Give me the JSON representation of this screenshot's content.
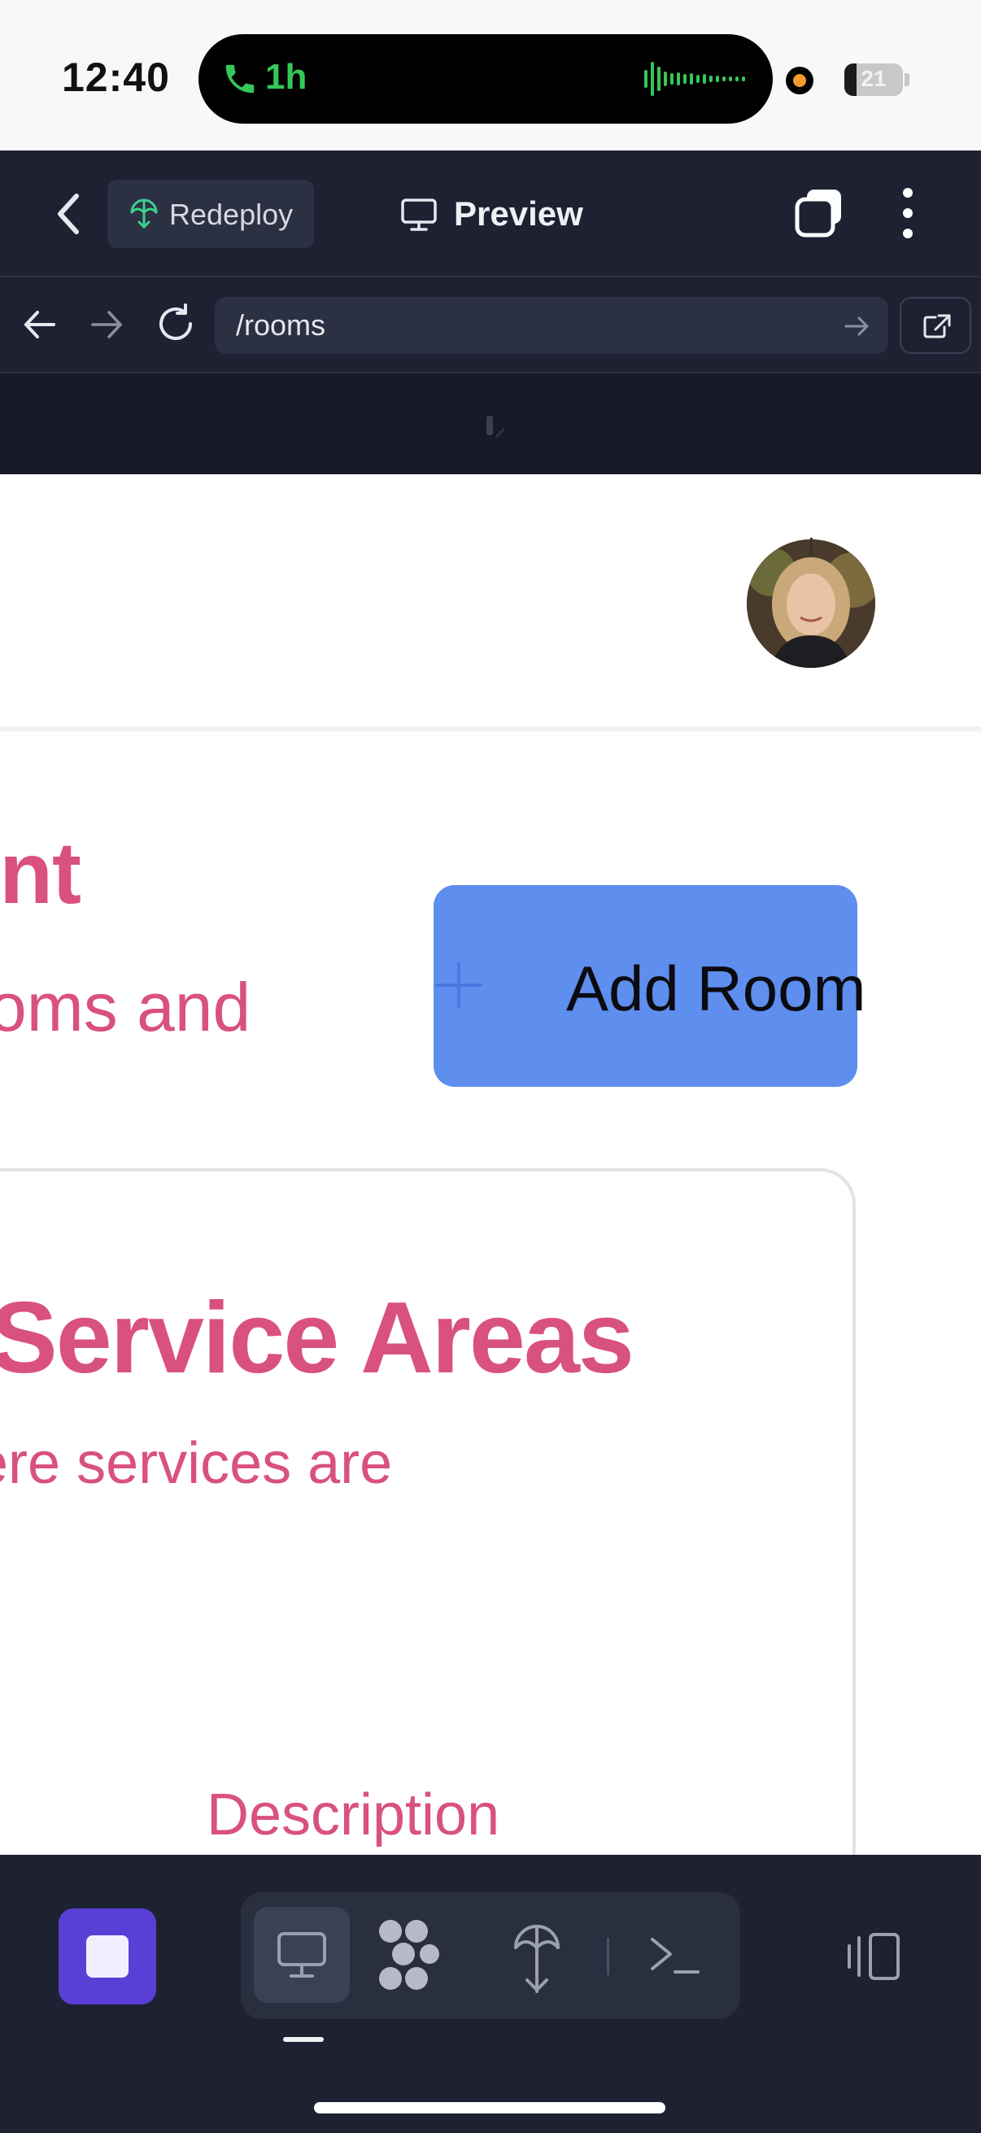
{
  "status_bar": {
    "time": "12:40",
    "call_duration": "1h",
    "battery_level": "21",
    "battery_fraction": 0.21,
    "call_color": "#34c759",
    "recording_color": "#f59a2c"
  },
  "app_toolbar": {
    "redeploy_label": "Redeploy",
    "preview_label": "Preview",
    "icons": [
      "back-icon",
      "redeploy-icon",
      "monitor-icon",
      "tabs-icon",
      "more-vertical-icon"
    ]
  },
  "address_bar": {
    "url": "/rooms",
    "icons": [
      "arrow-left-icon",
      "arrow-right-icon",
      "reload-icon",
      "go-arrow-icon",
      "open-external-icon"
    ]
  },
  "page": {
    "title": "ent",
    "subtitle": "oms and",
    "add_room_label": "Add Room",
    "card": {
      "title": "Service Areas",
      "subtitle": "ere services are",
      "description_label": "Description"
    },
    "colors": {
      "accent_pink": "#d9517e",
      "button_blue": "#5e8eee"
    }
  },
  "bottom_toolbar": {
    "icons": [
      "stop-icon",
      "monitor-icon",
      "apps-icon",
      "deploy-icon",
      "terminal-icon",
      "panel-toggle-icon"
    ],
    "active_tool": "monitor",
    "stop_color": "#5a3fd6",
    "background": "#1d2131"
  }
}
